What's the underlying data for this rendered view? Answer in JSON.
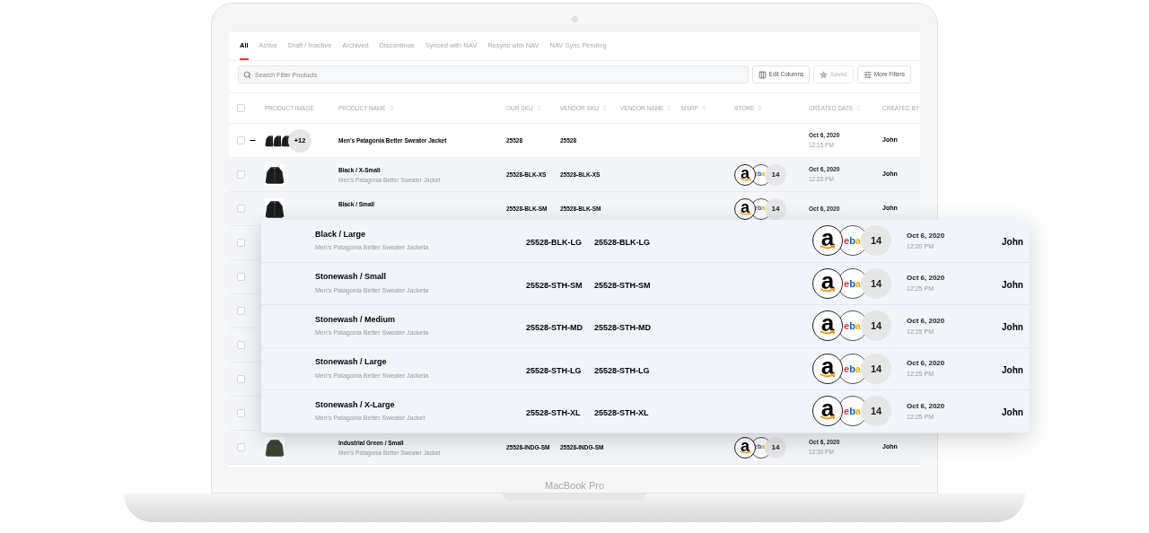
{
  "tabs": [
    {
      "label": "All",
      "selected": true
    },
    {
      "label": "Active",
      "selected": false
    },
    {
      "label": "Draft / Inactive",
      "selected": false
    },
    {
      "label": "Archived",
      "selected": false
    },
    {
      "label": "Discontinue",
      "selected": false
    },
    {
      "label": "Synced with NAV",
      "selected": false
    },
    {
      "label": "Resync with NAV",
      "selected": false
    },
    {
      "label": "NAV Sync Pending",
      "selected": false
    }
  ],
  "search": {
    "placeholder": "Search Filter Products"
  },
  "toolbar_buttons": [
    {
      "kind": "columns",
      "label": "Edit Columns",
      "disabled": false
    },
    {
      "kind": "star",
      "label": "Saved",
      "disabled": true
    },
    {
      "kind": "filters",
      "label": "More Filters",
      "disabled": false
    }
  ],
  "table": {
    "select_all": {
      "checked": false
    },
    "columns": [
      {
        "label": "PRODUCT IMAGE",
        "sortable": false
      },
      {
        "label": "PRODUCT NAME",
        "sortable": true
      },
      {
        "label": "OUR SKU",
        "sortable": true
      },
      {
        "label": "VENDOR SKU",
        "sortable": true
      },
      {
        "label": "VENDOR NAME",
        "sortable": true
      },
      {
        "label": "MSRP",
        "sortable": true
      },
      {
        "label": "STORE",
        "sortable": true
      },
      {
        "label": "CREATED DATE",
        "sortable": true
      },
      {
        "label": "CREATED BY",
        "sortable": false
      }
    ],
    "parent_row": {
      "checked": false,
      "expanded": true,
      "more_images": "+12",
      "name": "Men's Patagonia Better Sweater Jacket",
      "our_sku": "25528",
      "vendor_sku": "25528",
      "date": "Oct 6, 2020",
      "time": "12:15 PM",
      "created_by": "John"
    },
    "rows": [
      {
        "kind": "variant",
        "checked": false,
        "name": "Black / X-Small",
        "subtitle": "Men's Patagonia Better Sweater Jacket",
        "our_sku": "25528-BLK-XS",
        "vendor_sku": "25528-BLK-XS",
        "logos": [
          {
            "kind": "amazon",
            "text": "a"
          },
          {
            "kind": "ebay",
            "text": "eba"
          }
        ],
        "store_count": "14",
        "date": "Oct 6, 2020",
        "time": "12:20 PM",
        "created_by": "John",
        "green": false
      },
      {
        "kind": "variant",
        "checked": false,
        "name": "Black / Small",
        "our_sku": "25528-BLK-SM",
        "vendor_sku": "25528-BLK-SM",
        "logos": [
          {
            "kind": "amazon",
            "text": "a"
          },
          {
            "kind": "ebay",
            "text": "eba"
          }
        ],
        "store_count": "14",
        "date": "Oct 6, 2020",
        "created_by": "John",
        "green": false
      },
      {
        "kind": "covered",
        "checked": false
      },
      {
        "kind": "covered",
        "checked": false
      },
      {
        "kind": "covered",
        "checked": false
      },
      {
        "kind": "covered",
        "checked": false
      },
      {
        "kind": "covered",
        "checked": false
      },
      {
        "kind": "covered",
        "checked": false
      },
      {
        "kind": "variant",
        "checked": false,
        "name": "Industrial Green / Small",
        "subtitle": "Men's Patagonia Better Sweater Jacket",
        "our_sku": "25528-INDG-SM",
        "vendor_sku": "25528-INDG-SM",
        "logos": [
          {
            "kind": "amazon",
            "text": "a"
          },
          {
            "kind": "ebay",
            "text": "eba"
          }
        ],
        "store_count": "14",
        "date": "Oct 6, 2020",
        "time": "12:30 PM",
        "created_by": "John",
        "green": true
      }
    ]
  },
  "overlay_rows": [
    {
      "name": "Black / Large",
      "subtitle": "Men's Patagonia Better Sweater Jacketa",
      "our_sku": "25528-BLK-LG",
      "vendor_sku": "25528-BLK-LG",
      "logos": [
        {
          "kind": "amazon",
          "text": "a"
        },
        {
          "kind": "ebay",
          "text": "eba"
        }
      ],
      "store_count": "14",
      "date": "Oct 6, 2020",
      "time": "12:20 PM",
      "created_by": "John"
    },
    {
      "name": "Stonewash / Small",
      "subtitle": "Men's Patagonia Better Sweater Jacketa",
      "our_sku": "25528-STH-SM",
      "vendor_sku": "25528-STH-SM",
      "logos": [
        {
          "kind": "amazon",
          "text": "a"
        },
        {
          "kind": "ebay",
          "text": "eba"
        }
      ],
      "store_count": "14",
      "date": "Oct 6, 2020",
      "time": "12:25 PM",
      "created_by": "John"
    },
    {
      "name": "Stonewash / Medium",
      "subtitle": "Men's Patagonia Better Sweater Jacketa",
      "our_sku": "25528-STH-MD",
      "vendor_sku": "25528-STH-MD",
      "logos": [
        {
          "kind": "amazon",
          "text": "a"
        },
        {
          "kind": "ebay",
          "text": "eba"
        }
      ],
      "store_count": "14",
      "date": "Oct 6, 2020",
      "time": "12:25 PM",
      "created_by": "John"
    },
    {
      "name": "Stonewash / Large",
      "subtitle": "Men's Patagonia Better Sweater Jacketa",
      "our_sku": "25528-STH-LG",
      "vendor_sku": "25528-STH-LG",
      "logos": [
        {
          "kind": "amazon",
          "text": "a"
        },
        {
          "kind": "ebay",
          "text": "eba"
        }
      ],
      "store_count": "14",
      "date": "Oct 6, 2020",
      "time": "12:25 PM",
      "created_by": "John"
    },
    {
      "name": "Stonewash / X-Large",
      "subtitle": "Men's Patagonia Better Sweater Jacket",
      "our_sku": "25528-STH-XL",
      "vendor_sku": "25528-STH-XL",
      "logos": [
        {
          "kind": "amazon",
          "text": "a"
        },
        {
          "kind": "ebay",
          "text": "eba"
        }
      ],
      "store_count": "14",
      "date": "Oct 6, 2020",
      "time": "12:25 PM",
      "created_by": "John"
    }
  ],
  "device_label": "MacBook Pro"
}
